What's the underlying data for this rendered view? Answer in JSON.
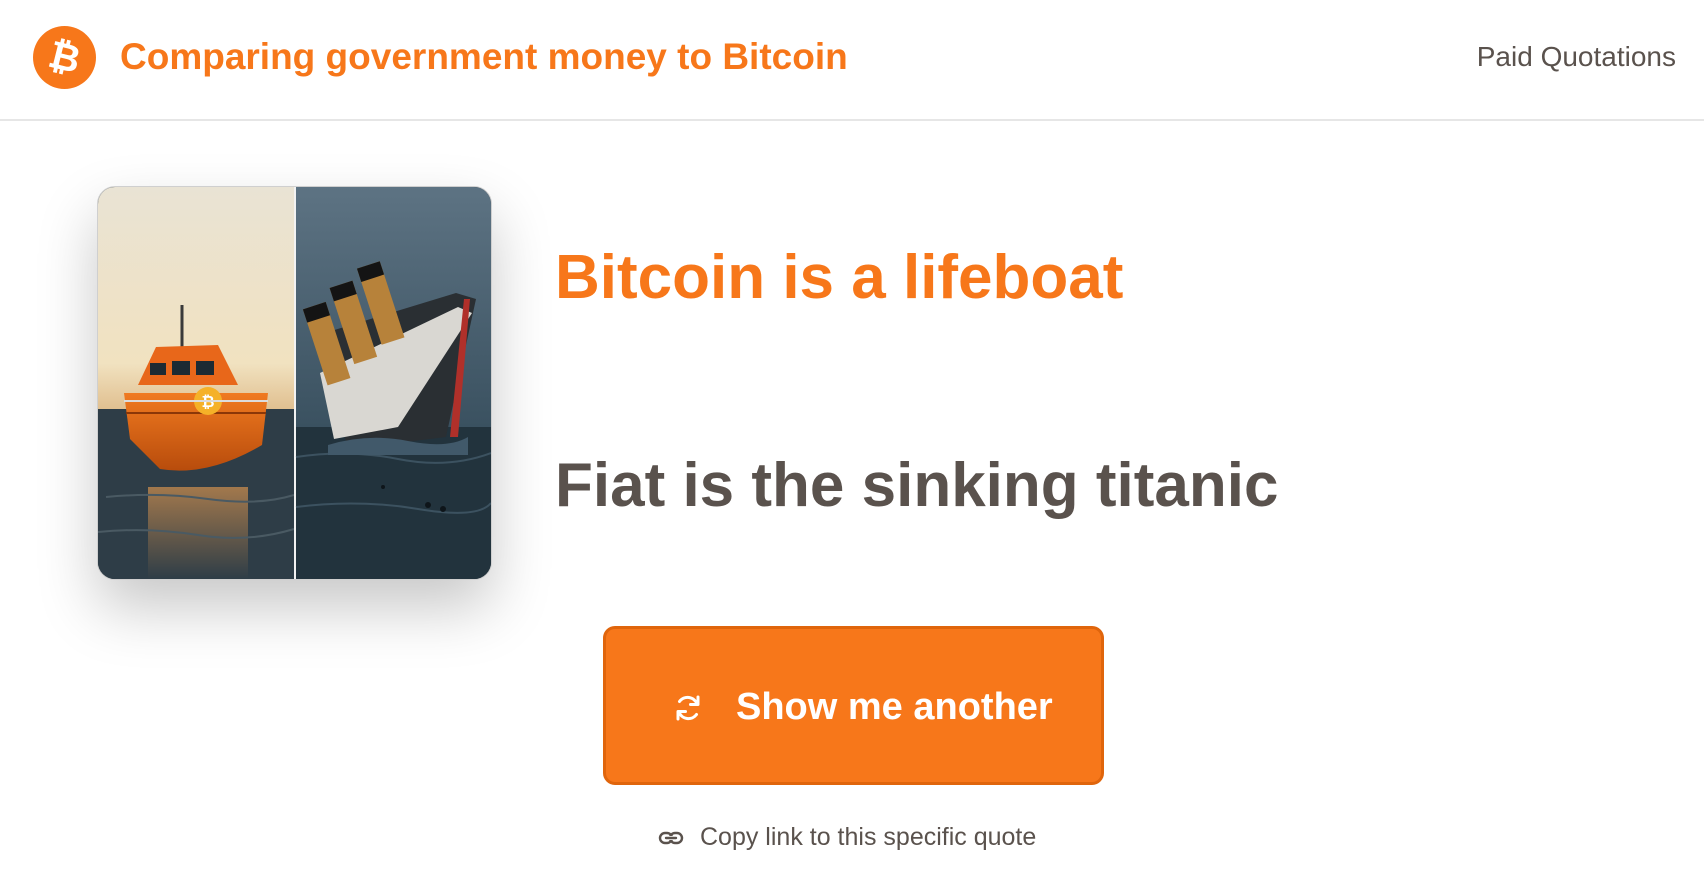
{
  "header": {
    "logo_icon": "bitcoin-icon",
    "title": "Comparing government money to Bitcoin",
    "nav_link": "Paid Quotations"
  },
  "image": {
    "left_icon": "bitcoin-icon",
    "left_subject": "orange-lifeboat",
    "right_subject": "sinking-titanic"
  },
  "quote": {
    "main": "Bitcoin is a lifeboat",
    "sub": "Fiat is the sinking titanic"
  },
  "actions": {
    "another_label": "Show me another",
    "another_icon": "refresh-icon",
    "copy_label": "Copy link to this specific quote",
    "copy_icon": "link-icon"
  },
  "colors": {
    "accent": "#f7771a",
    "text": "#5a524d",
    "background": "#ffffff"
  }
}
